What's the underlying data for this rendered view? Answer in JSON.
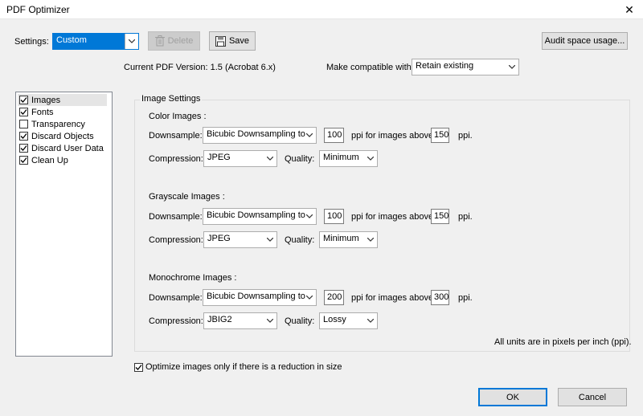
{
  "window": {
    "title": "PDF Optimizer",
    "close_glyph": "✕"
  },
  "toolbar": {
    "settings_label": "Settings:",
    "settings_value": "Custom",
    "delete_label": "Delete",
    "save_label": "Save",
    "audit_label": "Audit space usage..."
  },
  "version": {
    "current_label": "Current PDF Version: 1.5 (Acrobat 6.x)",
    "compat_label": "Make compatible with:",
    "compat_value": "Retain existing"
  },
  "sidebar": {
    "items": [
      {
        "label": "Images",
        "checked": true
      },
      {
        "label": "Fonts",
        "checked": true
      },
      {
        "label": "Transparency",
        "checked": false
      },
      {
        "label": "Discard Objects",
        "checked": true
      },
      {
        "label": "Discard User Data",
        "checked": true
      },
      {
        "label": "Clean Up",
        "checked": true
      }
    ]
  },
  "image_settings": {
    "group_title": "Image Settings",
    "color": {
      "heading": "Color Images :",
      "downsample_label": "Downsample:",
      "downsample_value": "Bicubic Downsampling to",
      "ppi_value": "100",
      "for_images_label": "ppi for images above",
      "above_value": "150",
      "ppi_suffix": "ppi.",
      "compression_label": "Compression:",
      "compression_value": "JPEG",
      "quality_label": "Quality:",
      "quality_value": "Minimum"
    },
    "grayscale": {
      "heading": "Grayscale Images :",
      "downsample_label": "Downsample:",
      "downsample_value": "Bicubic Downsampling to",
      "ppi_value": "100",
      "for_images_label": "ppi for images above",
      "above_value": "150",
      "ppi_suffix": "ppi.",
      "compression_label": "Compression:",
      "compression_value": "JPEG",
      "quality_label": "Quality:",
      "quality_value": "Minimum"
    },
    "monochrome": {
      "heading": "Monochrome Images :",
      "downsample_label": "Downsample:",
      "downsample_value": "Bicubic Downsampling to",
      "ppi_value": "200",
      "for_images_label": "ppi for images above",
      "above_value": "300",
      "ppi_suffix": "ppi.",
      "compression_label": "Compression:",
      "compression_value": "JBIG2",
      "quality_label": "Quality:",
      "quality_value": "Lossy"
    },
    "units_note": "All units are in pixels per inch (ppi)."
  },
  "optimize_checkbox": {
    "label": "Optimize images only if there is a reduction in size",
    "checked": true
  },
  "buttons": {
    "ok": "OK",
    "cancel": "Cancel"
  },
  "colors": {
    "accent": "#0078d7",
    "panel_bg": "#f0f0f0"
  }
}
